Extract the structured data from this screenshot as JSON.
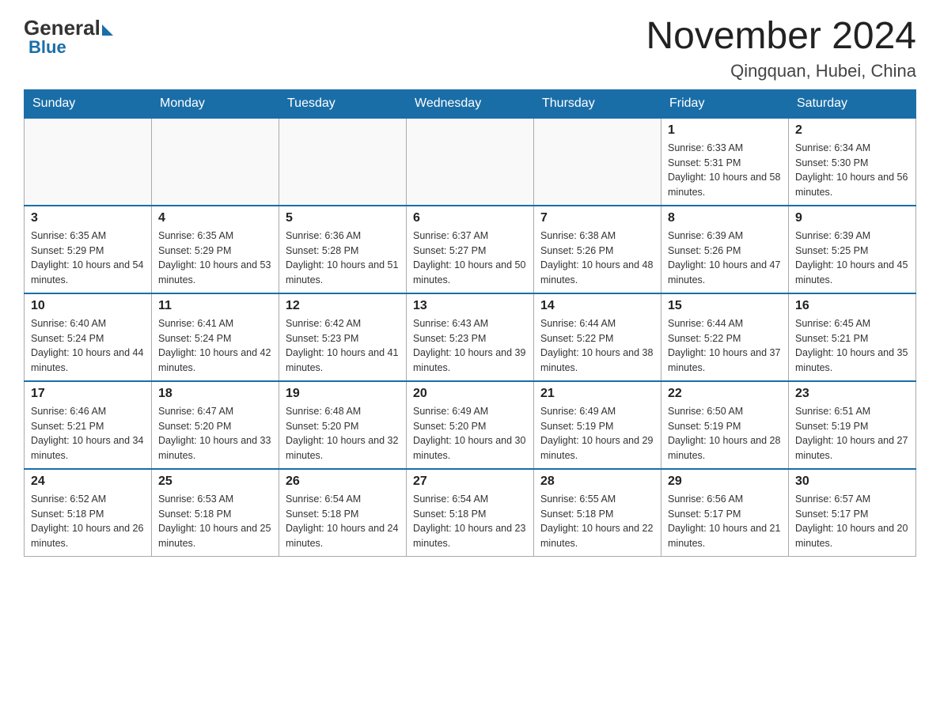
{
  "logo": {
    "general": "General",
    "blue": "Blue"
  },
  "header": {
    "month": "November 2024",
    "location": "Qingquan, Hubei, China"
  },
  "weekdays": [
    "Sunday",
    "Monday",
    "Tuesday",
    "Wednesday",
    "Thursday",
    "Friday",
    "Saturday"
  ],
  "weeks": [
    [
      {
        "day": "",
        "info": ""
      },
      {
        "day": "",
        "info": ""
      },
      {
        "day": "",
        "info": ""
      },
      {
        "day": "",
        "info": ""
      },
      {
        "day": "",
        "info": ""
      },
      {
        "day": "1",
        "info": "Sunrise: 6:33 AM\nSunset: 5:31 PM\nDaylight: 10 hours and 58 minutes."
      },
      {
        "day": "2",
        "info": "Sunrise: 6:34 AM\nSunset: 5:30 PM\nDaylight: 10 hours and 56 minutes."
      }
    ],
    [
      {
        "day": "3",
        "info": "Sunrise: 6:35 AM\nSunset: 5:29 PM\nDaylight: 10 hours and 54 minutes."
      },
      {
        "day": "4",
        "info": "Sunrise: 6:35 AM\nSunset: 5:29 PM\nDaylight: 10 hours and 53 minutes."
      },
      {
        "day": "5",
        "info": "Sunrise: 6:36 AM\nSunset: 5:28 PM\nDaylight: 10 hours and 51 minutes."
      },
      {
        "day": "6",
        "info": "Sunrise: 6:37 AM\nSunset: 5:27 PM\nDaylight: 10 hours and 50 minutes."
      },
      {
        "day": "7",
        "info": "Sunrise: 6:38 AM\nSunset: 5:26 PM\nDaylight: 10 hours and 48 minutes."
      },
      {
        "day": "8",
        "info": "Sunrise: 6:39 AM\nSunset: 5:26 PM\nDaylight: 10 hours and 47 minutes."
      },
      {
        "day": "9",
        "info": "Sunrise: 6:39 AM\nSunset: 5:25 PM\nDaylight: 10 hours and 45 minutes."
      }
    ],
    [
      {
        "day": "10",
        "info": "Sunrise: 6:40 AM\nSunset: 5:24 PM\nDaylight: 10 hours and 44 minutes."
      },
      {
        "day": "11",
        "info": "Sunrise: 6:41 AM\nSunset: 5:24 PM\nDaylight: 10 hours and 42 minutes."
      },
      {
        "day": "12",
        "info": "Sunrise: 6:42 AM\nSunset: 5:23 PM\nDaylight: 10 hours and 41 minutes."
      },
      {
        "day": "13",
        "info": "Sunrise: 6:43 AM\nSunset: 5:23 PM\nDaylight: 10 hours and 39 minutes."
      },
      {
        "day": "14",
        "info": "Sunrise: 6:44 AM\nSunset: 5:22 PM\nDaylight: 10 hours and 38 minutes."
      },
      {
        "day": "15",
        "info": "Sunrise: 6:44 AM\nSunset: 5:22 PM\nDaylight: 10 hours and 37 minutes."
      },
      {
        "day": "16",
        "info": "Sunrise: 6:45 AM\nSunset: 5:21 PM\nDaylight: 10 hours and 35 minutes."
      }
    ],
    [
      {
        "day": "17",
        "info": "Sunrise: 6:46 AM\nSunset: 5:21 PM\nDaylight: 10 hours and 34 minutes."
      },
      {
        "day": "18",
        "info": "Sunrise: 6:47 AM\nSunset: 5:20 PM\nDaylight: 10 hours and 33 minutes."
      },
      {
        "day": "19",
        "info": "Sunrise: 6:48 AM\nSunset: 5:20 PM\nDaylight: 10 hours and 32 minutes."
      },
      {
        "day": "20",
        "info": "Sunrise: 6:49 AM\nSunset: 5:20 PM\nDaylight: 10 hours and 30 minutes."
      },
      {
        "day": "21",
        "info": "Sunrise: 6:49 AM\nSunset: 5:19 PM\nDaylight: 10 hours and 29 minutes."
      },
      {
        "day": "22",
        "info": "Sunrise: 6:50 AM\nSunset: 5:19 PM\nDaylight: 10 hours and 28 minutes."
      },
      {
        "day": "23",
        "info": "Sunrise: 6:51 AM\nSunset: 5:19 PM\nDaylight: 10 hours and 27 minutes."
      }
    ],
    [
      {
        "day": "24",
        "info": "Sunrise: 6:52 AM\nSunset: 5:18 PM\nDaylight: 10 hours and 26 minutes."
      },
      {
        "day": "25",
        "info": "Sunrise: 6:53 AM\nSunset: 5:18 PM\nDaylight: 10 hours and 25 minutes."
      },
      {
        "day": "26",
        "info": "Sunrise: 6:54 AM\nSunset: 5:18 PM\nDaylight: 10 hours and 24 minutes."
      },
      {
        "day": "27",
        "info": "Sunrise: 6:54 AM\nSunset: 5:18 PM\nDaylight: 10 hours and 23 minutes."
      },
      {
        "day": "28",
        "info": "Sunrise: 6:55 AM\nSunset: 5:18 PM\nDaylight: 10 hours and 22 minutes."
      },
      {
        "day": "29",
        "info": "Sunrise: 6:56 AM\nSunset: 5:17 PM\nDaylight: 10 hours and 21 minutes."
      },
      {
        "day": "30",
        "info": "Sunrise: 6:57 AM\nSunset: 5:17 PM\nDaylight: 10 hours and 20 minutes."
      }
    ]
  ]
}
